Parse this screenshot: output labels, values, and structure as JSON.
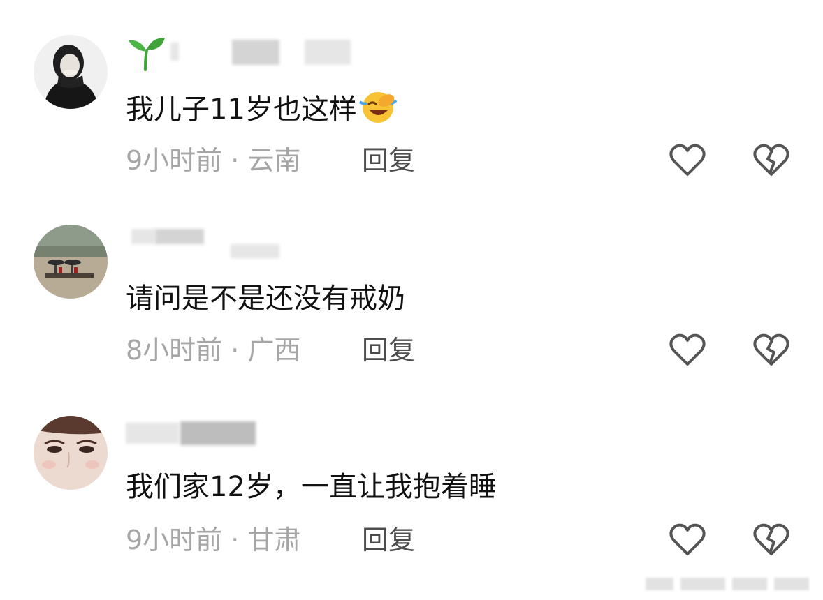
{
  "comments": [
    {
      "text": "我儿子11岁也这样",
      "emoji": "laughing-crying-emoji",
      "time": "9小时前",
      "separator": " · ",
      "location": "云南",
      "reply_label": "回复"
    },
    {
      "text": "请问是不是还没有戒奶",
      "time": "8小时前",
      "separator": " · ",
      "location": "广西",
      "reply_label": "回复"
    },
    {
      "text": "我们家12岁，一直让我抱着睡",
      "time": "9小时前",
      "separator": " · ",
      "location": "甘肃",
      "reply_label": "回复"
    }
  ],
  "icons": {
    "like": "heart-outline-icon",
    "dislike": "broken-heart-icon",
    "username_badge": "sprout-emoji"
  },
  "colors": {
    "text": "#111111",
    "meta": "#a6a6a6",
    "reply": "#4d4d4d",
    "icon_stroke": "#555555",
    "sprout_green": "#3fa33a",
    "emoji_yellow": "#f7c234"
  }
}
